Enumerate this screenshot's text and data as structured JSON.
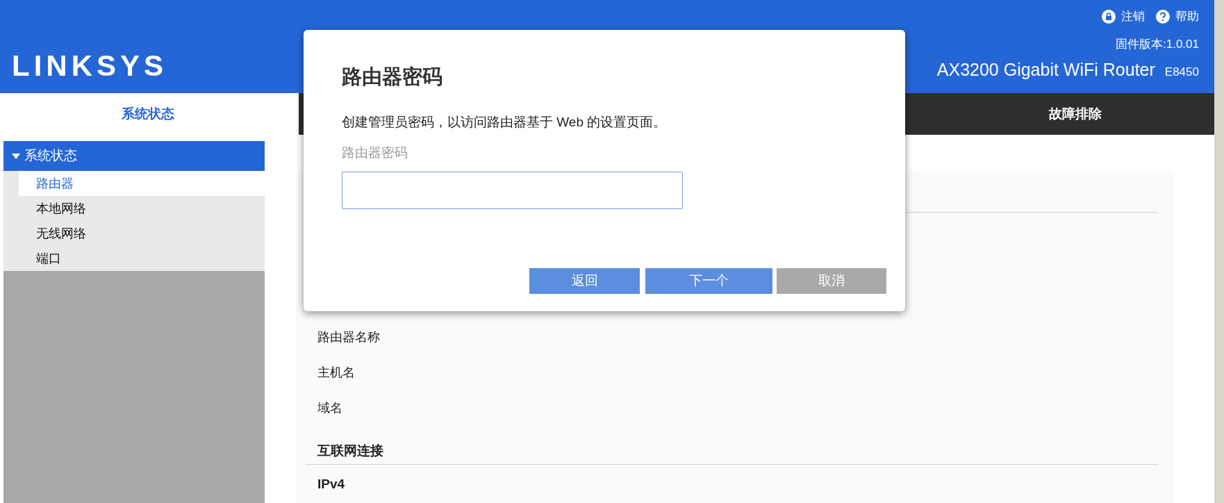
{
  "header": {
    "links": [
      {
        "kind": "lock",
        "label": "注销"
      },
      {
        "kind": "help",
        "label": "帮助"
      }
    ],
    "firmware": "固件版本:1.0.01",
    "logo": "LINKSYS",
    "product": "AX3200 Gigabit WiFi Router",
    "model": "E8450"
  },
  "sidebar": {
    "tab": "系统状态",
    "section": {
      "label": "系统状态",
      "expanded": true,
      "items": [
        {
          "label": "路由器",
          "selected": true
        },
        {
          "label": "本地网络",
          "selected": false
        },
        {
          "label": "无线网络",
          "selected": false
        },
        {
          "label": "端口",
          "selected": false
        }
      ]
    }
  },
  "nav_tabs": [
    {
      "label": "故障排除"
    }
  ],
  "content": {
    "rows": [
      {
        "kind": "label",
        "text": "路由器名称"
      },
      {
        "kind": "label",
        "text": "主机名"
      },
      {
        "kind": "label",
        "text": "域名"
      },
      {
        "kind": "heading",
        "text": "互联网连接"
      },
      {
        "kind": "subheading",
        "text": "IPv4"
      }
    ]
  },
  "dialog": {
    "title": "路由器密码",
    "description": "创建管理员密码，以访问路由器基于 Web 的设置页面。",
    "field_label": "路由器密码",
    "field_focused": true,
    "buttons": [
      {
        "label": "返回",
        "kind": "primary"
      },
      {
        "label": "下一个",
        "kind": "primary"
      },
      {
        "label": "取消",
        "kind": "secondary"
      }
    ]
  }
}
